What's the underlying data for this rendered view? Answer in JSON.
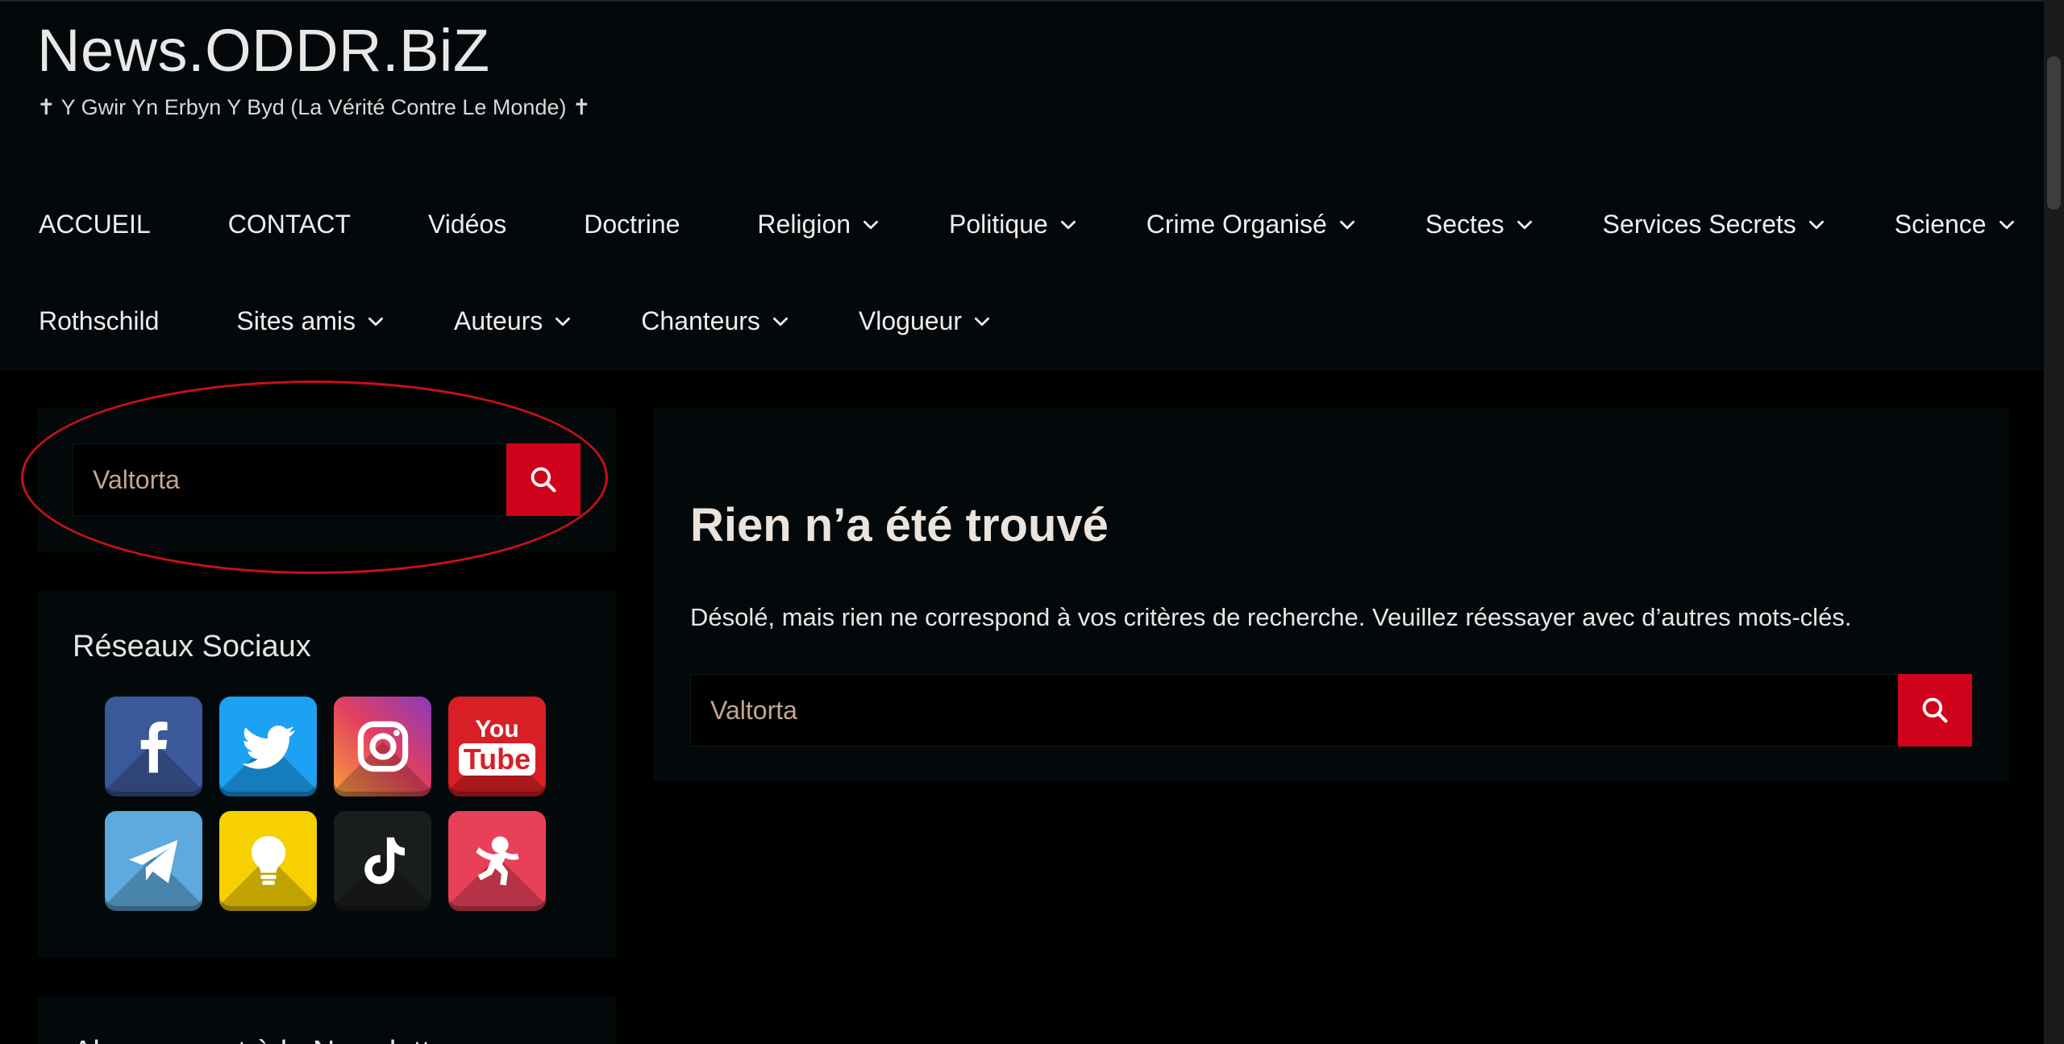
{
  "header": {
    "site_title": "News.ODDR.BiZ",
    "tagline": "✝ Y Gwir Yn Erbyn Y Byd (La Vérité Contre Le Monde) ✝"
  },
  "nav": {
    "row1": [
      {
        "label": "ACCUEIL",
        "has_submenu": false
      },
      {
        "label": "CONTACT",
        "has_submenu": false
      },
      {
        "label": "Vidéos",
        "has_submenu": false
      },
      {
        "label": "Doctrine",
        "has_submenu": false
      },
      {
        "label": "Religion",
        "has_submenu": true
      },
      {
        "label": "Politique",
        "has_submenu": true
      },
      {
        "label": "Crime Organisé",
        "has_submenu": true
      },
      {
        "label": "Sectes",
        "has_submenu": true
      },
      {
        "label": "Services Secrets",
        "has_submenu": true
      },
      {
        "label": "Science",
        "has_submenu": true
      }
    ],
    "row2": [
      {
        "label": "Rothschild",
        "has_submenu": false
      },
      {
        "label": "Sites amis",
        "has_submenu": true
      },
      {
        "label": "Auteurs",
        "has_submenu": true
      },
      {
        "label": "Chanteurs",
        "has_submenu": true
      },
      {
        "label": "Vlogueur",
        "has_submenu": true
      }
    ]
  },
  "sidebar": {
    "search": {
      "value": "Valtorta"
    },
    "social": {
      "title": "Réseaux Sociaux",
      "icons": [
        {
          "name": "facebook-icon",
          "color": "#3b5998"
        },
        {
          "name": "twitter-icon",
          "color": "#1da1f2"
        },
        {
          "name": "instagram-icon",
          "color": "#e1306c"
        },
        {
          "name": "youtube-icon",
          "color": "#d81f26",
          "text_top": "You",
          "text_bottom": "Tube"
        },
        {
          "name": "telegram-icon",
          "color": "#5ea9dd"
        },
        {
          "name": "lightbulb-icon",
          "color": "#f7d000"
        },
        {
          "name": "tiktok-icon",
          "color": "#1a1d1e"
        },
        {
          "name": "gab-icon",
          "color": "#e9405a"
        }
      ]
    },
    "newsletter": {
      "title": "Abonnement à la Newsletter"
    }
  },
  "main": {
    "heading": "Rien n’a été trouvé",
    "message": "Désolé, mais rien ne correspond à vos critères de recherche. Veuillez réessayer avec d’autres mots-clés.",
    "search": {
      "value": "Valtorta"
    }
  },
  "colors": {
    "accent": "#d0021b",
    "background": "#000000",
    "card": "#03080a",
    "annotation": "#c8101a"
  }
}
